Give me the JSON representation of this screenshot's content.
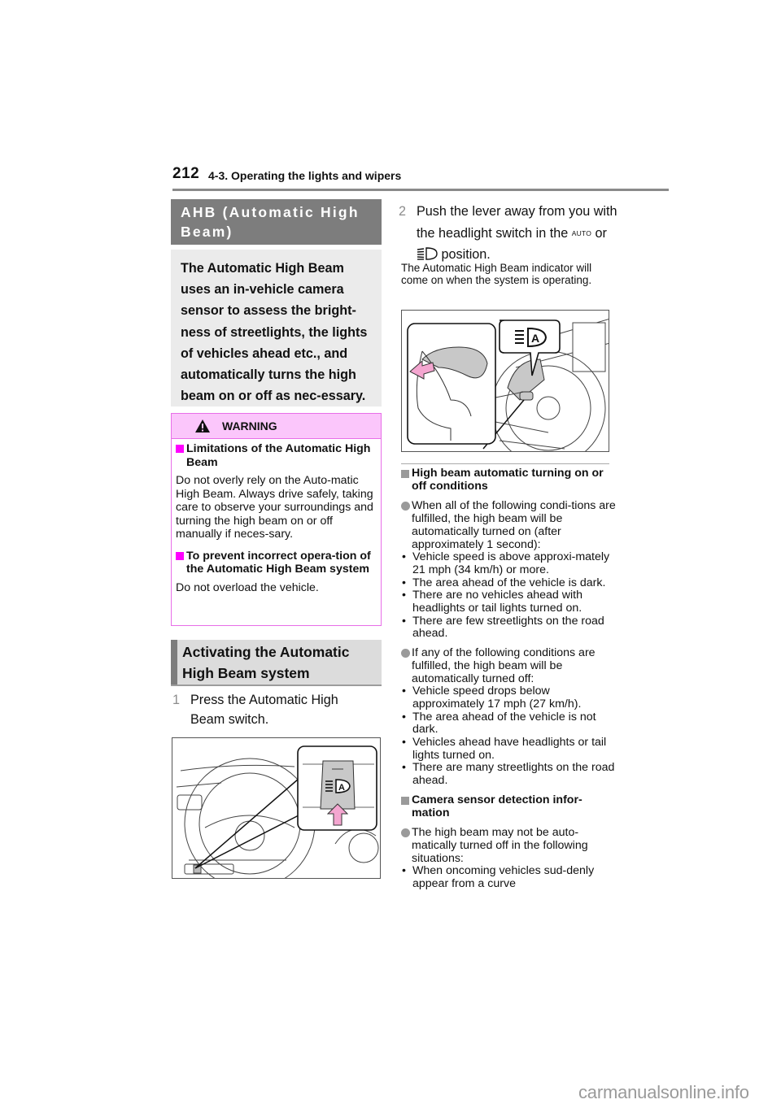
{
  "header": {
    "page_number": "212",
    "chapter": "4-3. Operating the lights and wipers"
  },
  "left": {
    "title": "AHB (Automatic High Beam)",
    "intro": "The Automatic High Beam uses an in-vehicle camera sensor to assess the bright-ness of streetlights, the lights of vehicles ahead etc., and automatically turns the high beam on or off as nec-essary.",
    "warning": {
      "label": "WARNING",
      "sections": [
        {
          "heading": "Limitations of the Automatic High Beam",
          "body": "Do not overly rely on the Auto-matic High Beam. Always drive safely, taking care to observe your surroundings and turning the high beam on or off manually if neces-sary."
        },
        {
          "heading": "To prevent incorrect opera-tion of the Automatic High Beam system",
          "body": "Do not overload the vehicle."
        }
      ]
    },
    "activating_title": "Activating the Automatic High Beam system",
    "step1": {
      "num": "1",
      "text": "Press the Automatic High Beam switch."
    }
  },
  "right": {
    "step2": {
      "num": "2",
      "text_a": "Push the lever away from you with the headlight switch in the",
      "auto": "AUTO",
      "text_b": "or",
      "text_c": "position."
    },
    "note": "The Automatic High Beam indicator will come on when the system is operating.",
    "sections": [
      {
        "heading": "High beam automatic turning on or off conditions",
        "items": [
          {
            "lead": "When all of the following condi-tions are fulfilled, the high beam will be automatically turned on (after approximately 1 second):",
            "bullets": [
              "Vehicle speed is above approxi-mately 21 mph (34 km/h) or more.",
              "The area ahead of the vehicle is dark.",
              "There are no vehicles ahead with headlights or tail lights turned on.",
              "There are few streetlights on the road ahead."
            ]
          },
          {
            "lead": "If any of the following conditions are fulfilled, the high beam will be automatically turned off:",
            "bullets": [
              "Vehicle speed drops below approximately 17 mph (27 km/h).",
              "The area ahead of the vehicle is not dark.",
              "Vehicles ahead have headlights or tail lights turned on.",
              "There are many streetlights on the road ahead."
            ]
          }
        ]
      },
      {
        "heading": "Camera sensor detection infor-mation",
        "items": [
          {
            "lead": "The high beam may not be auto-matically turned off in the following situations:",
            "bullets": [
              "When oncoming vehicles sud-denly appear from a curve"
            ]
          }
        ]
      }
    ]
  },
  "footer": {
    "brand": "carmanualsonline.info"
  },
  "icons": {
    "warning": "warning-triangle-icon",
    "ahb": "automatic-high-beam-icon",
    "headlight": "headlight-icon"
  },
  "colors": {
    "warning_border": "#e86ee8",
    "warning_header_bg": "#fbc6fb",
    "warning_square": "#ff00ff",
    "title_bg": "#7d7d7d",
    "arrow_pink": "#f4a6d0"
  }
}
